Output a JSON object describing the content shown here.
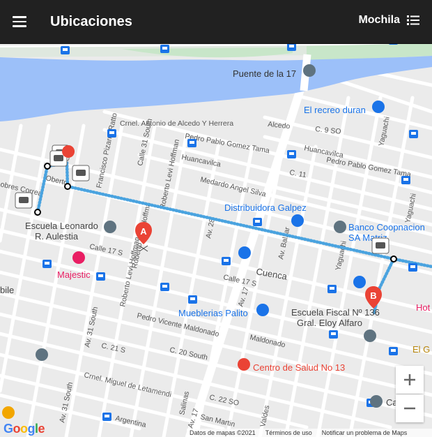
{
  "header": {
    "title": "Ubicaciones",
    "mochila_label": "Mochila"
  },
  "map": {
    "labels": {
      "puente": "Puente de la 17",
      "recreo": "El recreo duran",
      "distribuidora": "Distribuidora Galpez",
      "banco_1": "Banco Coopnacion",
      "banco_2": "SA Matriz",
      "escuela_leo_1": "Escuela Leonardo",
      "escuela_leo_2": "R. Aulestia",
      "majestic": "Majestic",
      "mueblerias": "Mueblerias Palito",
      "escuela_fiscal_1": "Escuela Fiscal Nº 136",
      "escuela_fiscal_2": "Gral. Eloy Alfaro",
      "centro_salud": "Centro de Salud No 13",
      "hot": "Hot",
      "el_g": "El G",
      "ca": "Ca",
      "cuenca": "Cuenca",
      "oberto": "Oberto",
      "obres_correa": "obres Correa",
      "bile": "bile",
      "calle_17s": "Calle 17 S",
      "calle_17s_b": "Calle 17 S",
      "c_9so": "C. 9 SO",
      "c_11": "C. 11",
      "c_21s": "C. 21 S",
      "c_22so": "C. 22 SO",
      "alcedo": "Alcedo",
      "cmnel": "Crnel. Antonio de Alcedo Y Herrera",
      "pedro_pablo_1": "Pedro Pablo Gomez Tama",
      "pedro_pablo_2": "Pedro Pablo Gomez Tama",
      "huancavilca_1": "Huancavilca",
      "huancavilca_2": "Huancavilca",
      "medardo": "Medardo Angel Silva",
      "pedro_vicente": "Pedro Vicente Maldonado",
      "maldonado": "Maldonado",
      "calle_20_south": "C. 20 South",
      "miguel_letamendi": "Crnel. Miguel de Letamendi",
      "argentina": "Argentina",
      "san_martin": "San Martin",
      "av_17": "Av. 17",
      "av_17b": "Av. 17",
      "av_28": "Av. 28",
      "av_balzar": "Av. Balzar",
      "yaguachi_1": "Yaguachi",
      "yaguachi_2": "Yaguachi",
      "yaguachi_3": "Yaguachi",
      "calle_31s": "Calle 31 South",
      "av_31s": "Av. 31 South",
      "av_31s_b": "Av. 31 South",
      "francisco": "Francisco Pizarro Ratto",
      "roberto_1": "Roberto Levi Hoffman",
      "roberto_2": "Roberto Levi Hoffman",
      "roberto_3": "Roberto Levi Hoffma",
      "salinas": "Salinas",
      "valdes": "Valdes",
      "marker_a": "A",
      "marker_b": "B"
    },
    "colors": {
      "water": "#9cc0f9",
      "park": "#c8e6c9",
      "route": "#4aa3df",
      "marker": "#ea4335",
      "poi_blue": "#1a73e8",
      "poi_pink": "#e91e63",
      "poi_grey": "#5f7380"
    },
    "footer": {
      "datos": "Datos de mapas ©2021",
      "terminos": "Términos de uso",
      "notificar": "Notificar un problema de Maps"
    },
    "google_logo": "Google"
  },
  "controls": {
    "zoom_in": "+",
    "zoom_out": "−"
  }
}
